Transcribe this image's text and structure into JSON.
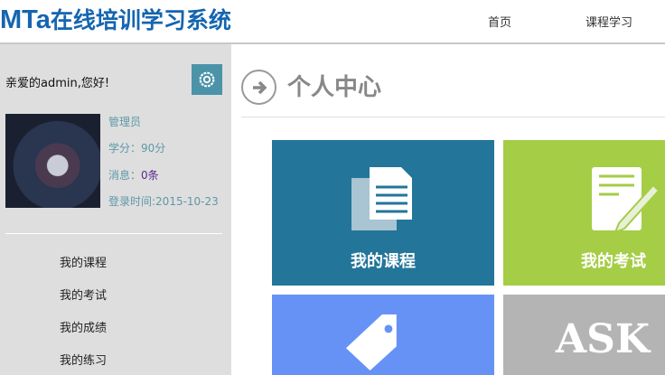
{
  "header": {
    "logo_text": "MTa",
    "logo_title": "在线培训学习系统",
    "nav": [
      {
        "label": "首页"
      },
      {
        "label": "课程学习"
      }
    ]
  },
  "sidebar": {
    "greeting": "亲爱的admin,您好!",
    "role": "管理员",
    "credits_label": "学分：",
    "credits_value": "90分",
    "messages_label": "消息：",
    "messages_value": "0条",
    "login_label": "登录时间:",
    "login_value": "2015-10-23",
    "menu": [
      {
        "label": "我的课程"
      },
      {
        "label": "我的考试"
      },
      {
        "label": "我的成绩"
      },
      {
        "label": "我的练习"
      }
    ]
  },
  "main": {
    "title": "个人中心",
    "tiles": [
      {
        "label": "我的课程",
        "color": "#23759a"
      },
      {
        "label": "我的考试",
        "color": "#a5cd46"
      },
      {
        "label": "",
        "color": "#6692f6"
      },
      {
        "label": "ASK",
        "color": "#b4b4b4"
      }
    ]
  }
}
